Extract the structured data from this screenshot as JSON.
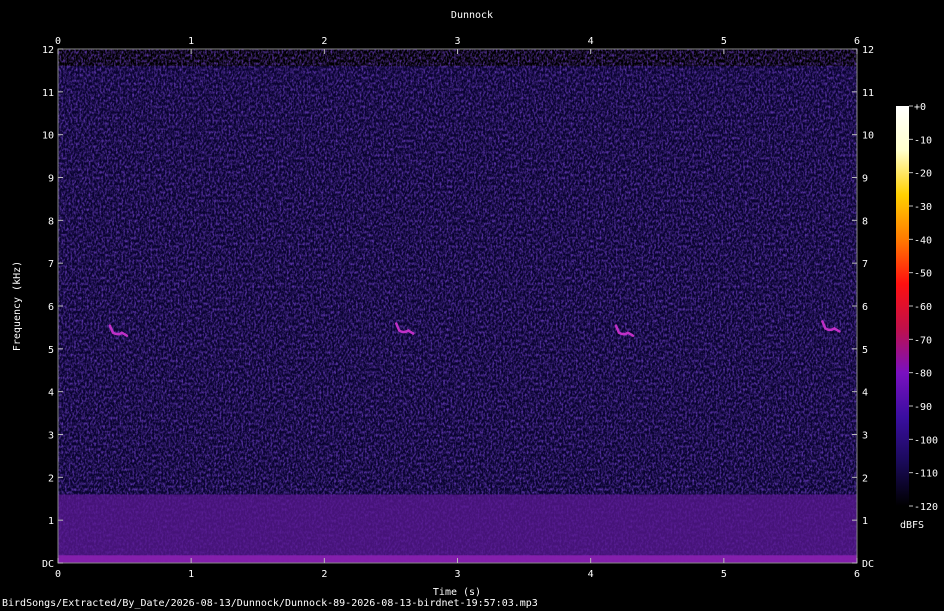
{
  "chart_data": {
    "type": "heatmap",
    "title": "Dunnock",
    "xlabel": "Time (s)",
    "ylabel": "Frequency (kHz)",
    "xlim": [
      0,
      6
    ],
    "ylim": [
      0,
      12
    ],
    "x_ticks": [
      "0",
      "1",
      "2",
      "3",
      "4",
      "5",
      "6"
    ],
    "y_ticks": [
      "DC",
      "1",
      "2",
      "3",
      "4",
      "5",
      "6",
      "7",
      "8",
      "9",
      "10",
      "11",
      "12"
    ],
    "colorbar": {
      "label": "dBFS",
      "ticks": [
        "+0",
        "-10",
        "-20",
        "-30",
        "-40",
        "-50",
        "-60",
        "-70",
        "-80",
        "-90",
        "-100",
        "-110",
        "-120"
      ],
      "range": [
        -120,
        0
      ],
      "colors": [
        "#000000",
        "#1a0a5a",
        "#3a0ea0",
        "#7a10c0",
        "#c0104a",
        "#ff1010",
        "#ff7a00",
        "#ffd000",
        "#ffffcc",
        "#ffffff"
      ]
    },
    "background_level_dbfs": -105,
    "low_band": {
      "freq_khz": [
        0,
        1.6
      ],
      "level_dbfs": -85
    },
    "calls": [
      {
        "time_s": 0.45,
        "freq_khz": 5.4
      },
      {
        "time_s": 2.6,
        "freq_khz": 5.45
      },
      {
        "time_s": 4.25,
        "freq_khz": 5.4
      },
      {
        "time_s": 5.8,
        "freq_khz": 5.5
      }
    ]
  },
  "footer": {
    "filepath": "BirdSongs/Extracted/By_Date/2026-08-13/Dunnock/Dunnock-89-2026-08-13-birdnet-19:57:03.mp3"
  }
}
